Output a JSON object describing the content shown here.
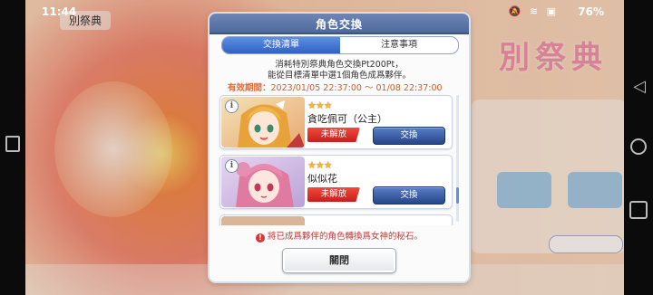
{
  "status_bar": {
    "time": "11:44",
    "battery": "76%",
    "icons": "🔕 ≋ ▣"
  },
  "background": {
    "tab_label": "別祭典",
    "title": "別祭典"
  },
  "dialog": {
    "title": "角色交換",
    "tabs": [
      {
        "label": "交換清單",
        "active": true
      },
      {
        "label": "注意事項",
        "active": false
      }
    ],
    "description": [
      "消耗特別祭典角色交換Pt200Pt，",
      "能從目標清單中選1個角色成爲夥伴。"
    ],
    "period": {
      "label": "有效期間：",
      "value": "2023/01/05 22:37:00 〜 01/08 22:37:00"
    },
    "characters": [
      {
        "stars": "★★★",
        "name": "貪吃佩可（公主）",
        "status": "未解放",
        "button": "交換"
      },
      {
        "stars": "★★★",
        "name": "似似花",
        "status": "未解放",
        "button": "交換"
      }
    ],
    "info_glyph": "i",
    "warning": "將已成爲夥伴的角色轉換爲女神的秘石。",
    "close_label": "關閉"
  },
  "colors": {
    "header": "#5a73a8",
    "accent_blue": "#2f62c2",
    "badge_red": "#d82a24",
    "period_orange": "#e06a30",
    "warning_red": "#c43a3a"
  }
}
